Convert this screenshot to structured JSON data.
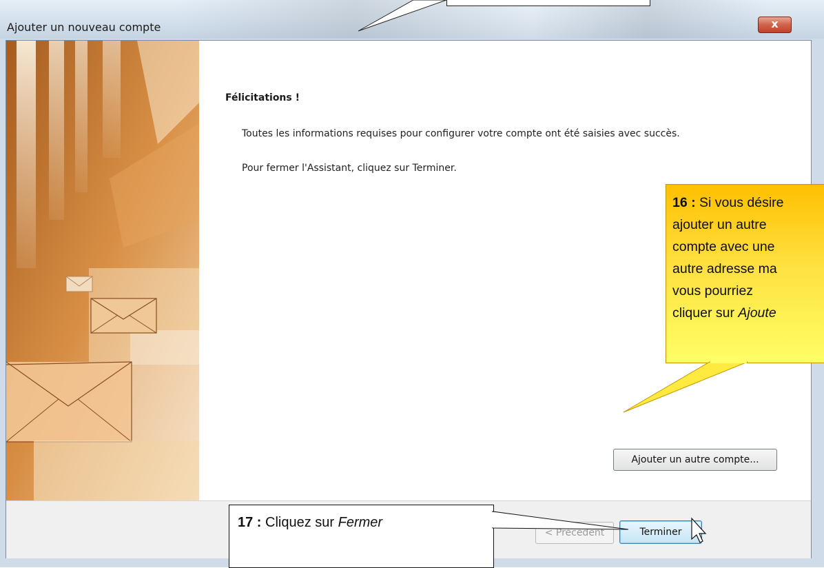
{
  "window": {
    "title": "Ajouter un nouveau compte",
    "close_label": "x"
  },
  "content": {
    "heading": "Félicitations !",
    "line1": "Toutes les informations requises pour configurer votre compte ont été saisies avec succès.",
    "line2": "Pour fermer l'Assistant, cliquez sur Terminer.",
    "add_account_button": "Ajouter un autre compte..."
  },
  "footer": {
    "prev_button": "< Précédent",
    "finish_button": "Terminer"
  },
  "annotations": {
    "c16": {
      "number": "16 :",
      "line1_rest": " Si vous désire",
      "line2": "ajouter un autre",
      "line3": "compte avec une",
      "line4": "autre adresse ma",
      "line5": "vous pourriez",
      "line6_pre": "cliquer sur ",
      "line6_ital": "Ajoute"
    },
    "c17": {
      "number": "17 :",
      "pre": " Cliquez sur ",
      "ital": "Fermer"
    }
  },
  "colors": {
    "callout_yellow": "#ffe040",
    "callout_orange": "#ffc000",
    "close_red": "#c2412a",
    "finish_blue": "#c4e5f6"
  }
}
